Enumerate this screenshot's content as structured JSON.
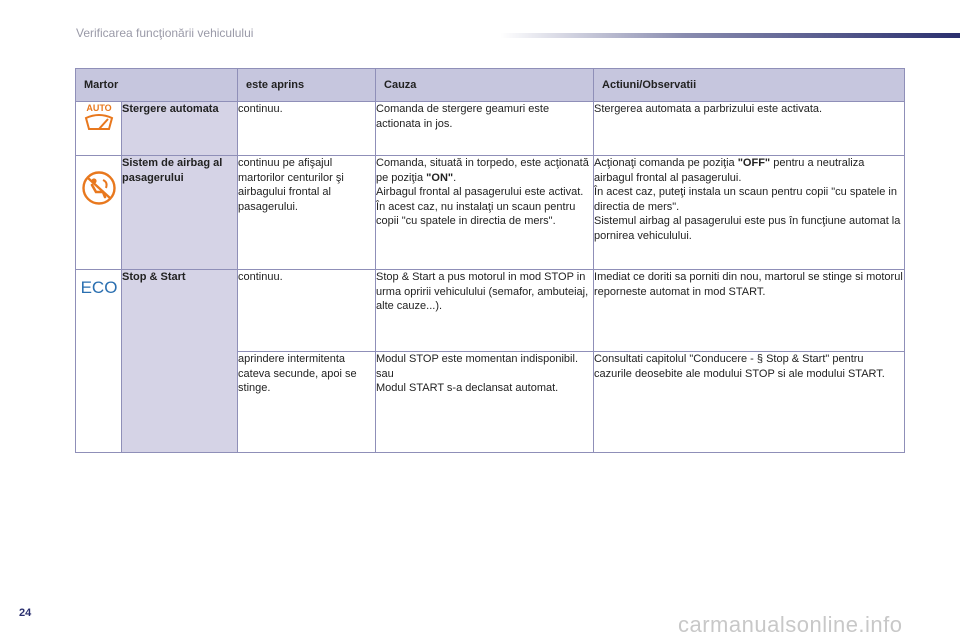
{
  "page": {
    "header_title": "Verificarea funcţionării vehiculului",
    "page_number": "24",
    "watermark": "carmanualsonline.info"
  },
  "table": {
    "headers": [
      "Martor",
      "este aprins",
      "Cauza",
      "Actiuni/Observatii"
    ],
    "rows": [
      {
        "icon": "wiper-auto-icon",
        "icon_text": "AUTO",
        "name": "Stergere automata",
        "lit": "continuu.",
        "cause": "Comanda de stergere geamuri este actionata in jos.",
        "action": "Stergerea automata a parbrizului este activata."
      },
      {
        "icon": "passenger-airbag-off-icon",
        "name": "Sistem de airbag al pasagerului",
        "lit": "continuu pe afişajul martorilor centurilor şi airbagului frontal al pasagerului.",
        "cause_a": "Comanda, situată in torpedo, este acţionată pe poziţia ",
        "cause_b": "\"ON\"",
        "cause_c": ".",
        "cause_d": "Airbagul frontal al pasagerului este activat.",
        "cause_e": "În acest caz, nu instalaţi un scaun pentru copii \"cu spatele in directia de mers\".",
        "action_a": "Acţionaţi comanda pe poziţia ",
        "action_b": "\"OFF\"",
        "action_c": " pentru a neutraliza airbagul frontal al pasagerului.",
        "action_d": "În acest caz, puteţi instala un scaun pentru copii \"cu spatele in directia de mers\".",
        "action_e": "Sistemul airbag al pasagerului este pus în funcţiune automat la pornirea vehiculului."
      },
      {
        "icon": "eco-icon",
        "icon_text": "ECO",
        "name": "Stop & Start",
        "lit": "continuu.",
        "cause": "Stop & Start a pus motorul in mod STOP in urma opririi vehiculului (semafor, ambuteiaj, alte cauze...).",
        "action": "Imediat ce doriti sa porniti din nou, martorul se stinge si motorul reporneste automat in mod START."
      },
      {
        "lit": "aprindere intermitenta cateva secunde, apoi se stinge.",
        "cause_a": "Modul STOP este momentan indisponibil.",
        "cause_b": "sau",
        "cause_c": "Modul START s-a declansat automat.",
        "action": "Consultati capitolul \"Conducere - § Stop & Start\" pentru cazurile deosebite ale modului STOP si ale modului START."
      }
    ]
  },
  "colors": {
    "header_bg": "#c6c6de",
    "name_bg": "#d5d3e6",
    "accent": "#2a2f6e",
    "border": "#8f8fb8"
  }
}
